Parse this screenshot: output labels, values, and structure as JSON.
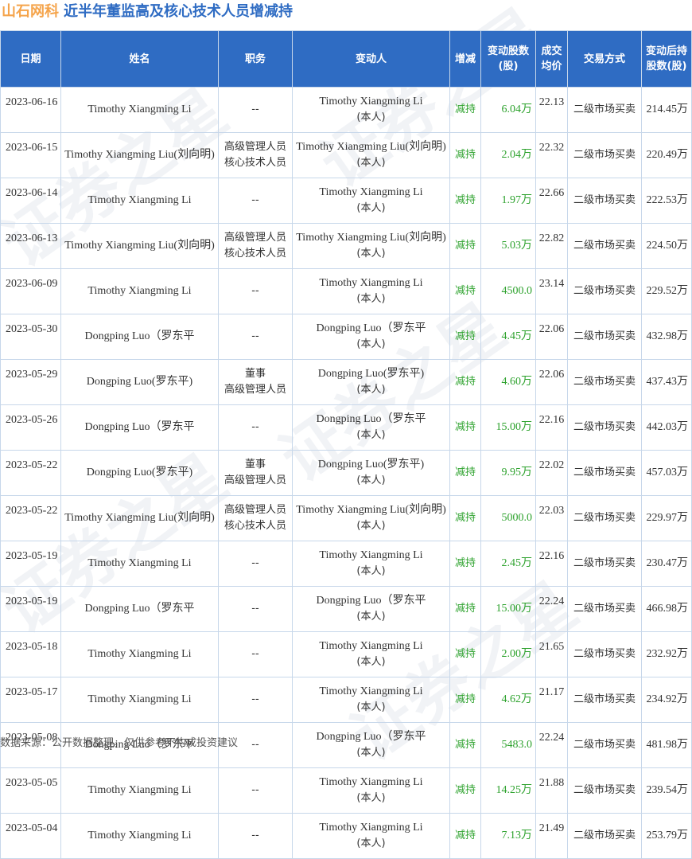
{
  "header": {
    "brand": "山石网科",
    "title": "近半年董监高及核心技术人员增减持"
  },
  "columns": {
    "date": "日期",
    "name": "姓名",
    "position": "职务",
    "changer": "变动人",
    "action": "增减",
    "amount": "变动股数(股)",
    "price": "成交均价",
    "method": "交易方式",
    "after": "变动后持股数(股)"
  },
  "rows": [
    {
      "date": "2023-06-16",
      "name": "Timothy Xiangming Li",
      "position": "--",
      "changer": "Timothy Xiangming Li",
      "changer_note": "(本人)",
      "action": "减持",
      "amount": "6.04万",
      "price": "22.13",
      "method": "二级市场买卖",
      "after": "214.45万"
    },
    {
      "date": "2023-06-15",
      "name": "Timothy Xiangming Liu(刘向明)",
      "position": "高级管理人员\n核心技术人员",
      "changer": "Timothy Xiangming Liu(刘向明)",
      "changer_note": "(本人)",
      "action": "减持",
      "amount": "2.04万",
      "price": "22.32",
      "method": "二级市场买卖",
      "after": "220.49万"
    },
    {
      "date": "2023-06-14",
      "name": "Timothy Xiangming Li",
      "position": "--",
      "changer": "Timothy Xiangming Li",
      "changer_note": "(本人)",
      "action": "减持",
      "amount": "1.97万",
      "price": "22.66",
      "method": "二级市场买卖",
      "after": "222.53万"
    },
    {
      "date": "2023-06-13",
      "name": "Timothy Xiangming Liu(刘向明)",
      "position": "高级管理人员\n核心技术人员",
      "changer": "Timothy Xiangming Liu(刘向明)",
      "changer_note": "(本人)",
      "action": "减持",
      "amount": "5.03万",
      "price": "22.82",
      "method": "二级市场买卖",
      "after": "224.50万"
    },
    {
      "date": "2023-06-09",
      "name": "Timothy Xiangming Li",
      "position": "--",
      "changer": "Timothy Xiangming Li",
      "changer_note": "(本人)",
      "action": "减持",
      "amount": "4500.0",
      "price": "23.14",
      "method": "二级市场买卖",
      "after": "229.52万"
    },
    {
      "date": "2023-05-30",
      "name": "Dongping Luo（罗东平",
      "position": "--",
      "changer": "Dongping Luo（罗东平",
      "changer_note": "(本人)",
      "action": "减持",
      "amount": "4.45万",
      "price": "22.06",
      "method": "二级市场买卖",
      "after": "432.98万"
    },
    {
      "date": "2023-05-29",
      "name": "Dongping Luo(罗东平)",
      "position": "董事\n高级管理人员",
      "changer": "Dongping Luo(罗东平)",
      "changer_note": "(本人)",
      "action": "减持",
      "amount": "4.60万",
      "price": "22.06",
      "method": "二级市场买卖",
      "after": "437.43万"
    },
    {
      "date": "2023-05-26",
      "name": "Dongping Luo（罗东平",
      "position": "--",
      "changer": "Dongping Luo（罗东平",
      "changer_note": "(本人)",
      "action": "减持",
      "amount": "15.00万",
      "price": "22.16",
      "method": "二级市场买卖",
      "after": "442.03万"
    },
    {
      "date": "2023-05-22",
      "name": "Dongping Luo(罗东平)",
      "position": "董事\n高级管理人员",
      "changer": "Dongping Luo(罗东平)",
      "changer_note": "(本人)",
      "action": "减持",
      "amount": "9.95万",
      "price": "22.02",
      "method": "二级市场买卖",
      "after": "457.03万"
    },
    {
      "date": "2023-05-22",
      "name": "Timothy Xiangming Liu(刘向明)",
      "position": "高级管理人员\n核心技术人员",
      "changer": "Timothy Xiangming Liu(刘向明)",
      "changer_note": "(本人)",
      "action": "减持",
      "amount": "5000.0",
      "price": "22.03",
      "method": "二级市场买卖",
      "after": "229.97万"
    },
    {
      "date": "2023-05-19",
      "name": "Timothy Xiangming Li",
      "position": "--",
      "changer": "Timothy Xiangming Li",
      "changer_note": "(本人)",
      "action": "减持",
      "amount": "2.45万",
      "price": "22.16",
      "method": "二级市场买卖",
      "after": "230.47万"
    },
    {
      "date": "2023-05-19",
      "name": "Dongping Luo（罗东平",
      "position": "--",
      "changer": "Dongping Luo（罗东平",
      "changer_note": "(本人)",
      "action": "减持",
      "amount": "15.00万",
      "price": "22.24",
      "method": "二级市场买卖",
      "after": "466.98万"
    },
    {
      "date": "2023-05-18",
      "name": "Timothy Xiangming Li",
      "position": "--",
      "changer": "Timothy Xiangming Li",
      "changer_note": "(本人)",
      "action": "减持",
      "amount": "2.00万",
      "price": "21.65",
      "method": "二级市场买卖",
      "after": "232.92万"
    },
    {
      "date": "2023-05-17",
      "name": "Timothy Xiangming Li",
      "position": "--",
      "changer": "Timothy Xiangming Li",
      "changer_note": "(本人)",
      "action": "减持",
      "amount": "4.62万",
      "price": "21.17",
      "method": "二级市场买卖",
      "after": "234.92万"
    },
    {
      "date": "2023-05-08",
      "name": "Dongping Luo（罗东平",
      "position": "--",
      "changer": "Dongping Luo（罗东平",
      "changer_note": "(本人)",
      "action": "减持",
      "amount": "5483.0",
      "price": "22.24",
      "method": "二级市场买卖",
      "after": "481.98万"
    },
    {
      "date": "2023-05-05",
      "name": "Timothy Xiangming Li",
      "position": "--",
      "changer": "Timothy Xiangming Li",
      "changer_note": "(本人)",
      "action": "减持",
      "amount": "14.25万",
      "price": "21.88",
      "method": "二级市场买卖",
      "after": "239.54万"
    },
    {
      "date": "2023-05-04",
      "name": "Timothy Xiangming Li",
      "position": "--",
      "changer": "Timothy Xiangming Li",
      "changer_note": "(本人)",
      "action": "减持",
      "amount": "7.13万",
      "price": "21.49",
      "method": "二级市场买卖",
      "after": "253.79万"
    }
  ],
  "footer": {
    "source": "数据来源：公开数据整理，仅供参考不构成投资建议"
  },
  "watermark": "证券之星",
  "colors": {
    "header_bg": "#2f6cc3",
    "brand": "#f5a44b",
    "title": "#2f6cc3",
    "decrease": "#2da22d",
    "border": "#c7d7ea"
  }
}
